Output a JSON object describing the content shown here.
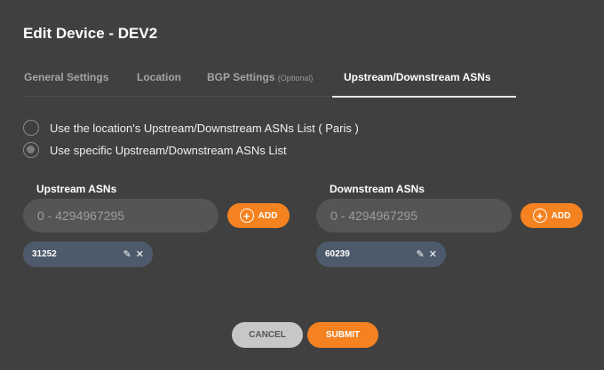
{
  "dialog": {
    "title": "Edit Device - DEV2"
  },
  "tabs": [
    {
      "label": "General Settings",
      "suffix": ""
    },
    {
      "label": "Location",
      "suffix": ""
    },
    {
      "label": "BGP Settings",
      "suffix": "(Optional)"
    },
    {
      "label": "Upstream/Downstream ASNs",
      "suffix": ""
    }
  ],
  "active_tab": "Upstream/Downstream ASNs",
  "options": {
    "location_list": "Use the location's Upstream/Downstream ASNs List ( Paris )",
    "specific_list": "Use specific Upstream/Downstream ASNs List",
    "selected": "specific_list"
  },
  "upstream": {
    "label": "Upstream ASNs",
    "placeholder": "0 - 4294967295",
    "value": "",
    "add_label": "ADD",
    "chips": [
      {
        "value": "31252"
      }
    ]
  },
  "downstream": {
    "label": "Downstream ASNs",
    "placeholder": "0 - 4294967295",
    "value": "",
    "add_label": "ADD",
    "chips": [
      {
        "value": "60239"
      }
    ]
  },
  "footer": {
    "cancel_label": "CANCEL",
    "submit_label": "SUBMIT"
  },
  "colors": {
    "background": "#404040",
    "accent": "#f58220",
    "chip": "#4d5a6b",
    "input": "#555555"
  },
  "icons": {
    "plus": "plus-circle-icon",
    "edit": "pencil-icon",
    "remove": "close-icon"
  }
}
